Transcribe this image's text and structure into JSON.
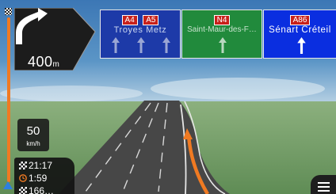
{
  "turn": {
    "distance_value": "400",
    "distance_unit": "m",
    "icon": "fork-turn-right-icon"
  },
  "signposts": [
    {
      "roads": [
        "A4",
        "A5"
      ],
      "text": "Troyes  Metz",
      "color": "#1d3aa8",
      "lanes": 3,
      "lane_color": "#9aa6d4"
    },
    {
      "roads": [
        "N4"
      ],
      "text": "Saint-Maur-des-F…",
      "color": "#218a3c",
      "lanes": 1,
      "lane_color": "#b9d8c0"
    },
    {
      "roads": [
        "A86"
      ],
      "text": "Sénart  Créteil",
      "color": "#0a2ee0",
      "lanes": 1,
      "lane_color": "#ffffff"
    }
  ],
  "speed": {
    "value": "50",
    "unit": "km/h"
  },
  "eta": {
    "arrival_time": "21:17",
    "remaining_time": "1:59",
    "remaining_distance": "166…"
  },
  "route": {
    "accent": "#f07a22"
  },
  "menu": {
    "icon": "hamburger-menu-icon"
  }
}
